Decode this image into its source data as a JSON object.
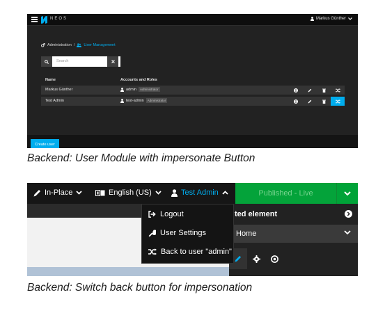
{
  "shot1": {
    "brand": "NEOS",
    "user_menu": "Markus Günther",
    "breadcrumb": {
      "section": "Administration",
      "separator": "/",
      "current": "User Management"
    },
    "search_placeholder": "Search",
    "table": {
      "headers": [
        "Name",
        "Accounts and Roles"
      ],
      "rows": [
        {
          "name": "Markus Günther",
          "account": "admin",
          "role": "Administrator"
        },
        {
          "name": "Test Admin",
          "account": "test-admin",
          "role": "Administrator"
        }
      ]
    },
    "create_button": "Create user",
    "colors": {
      "accent": "#00adee",
      "background": "#222222"
    }
  },
  "caption1": "Backend: User Module with impersonate Button",
  "shot2": {
    "edit_mode": "In-Place",
    "language": "English (US)",
    "user": "Test Admin",
    "publish_status": "Published - Live",
    "inspector_title": "ted element",
    "selected_page": "Home",
    "menu": [
      "Logout",
      "User Settings",
      "Back to user \"admin\""
    ],
    "colors": {
      "published": "#04a33a",
      "accent": "#00adee"
    }
  },
  "caption2": "Backend: Switch back button for impersonation"
}
